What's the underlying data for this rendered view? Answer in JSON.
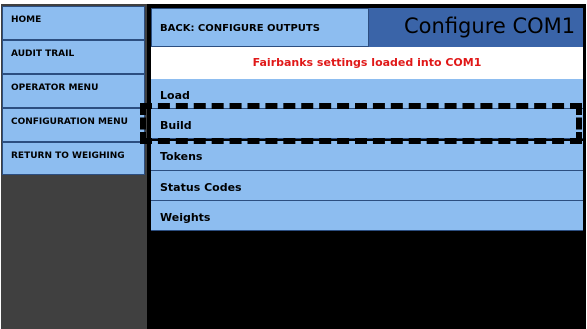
{
  "sidebar": {
    "items": [
      {
        "label": "HOME"
      },
      {
        "label": "AUDIT TRAIL"
      },
      {
        "label": "OPERATOR MENU"
      },
      {
        "label": "CONFIGURATION MENU"
      },
      {
        "label": "RETURN TO WEIGHING"
      }
    ]
  },
  "header": {
    "back_label": "BACK: CONFIGURE OUTPUTS",
    "title": "Configure COM1"
  },
  "status_message": "Fairbanks settings loaded into COM1",
  "menu": {
    "items": [
      {
        "label": "Load"
      },
      {
        "label": "Build"
      },
      {
        "label": "Tokens"
      },
      {
        "label": "Status Codes"
      },
      {
        "label": "Weights"
      }
    ]
  },
  "colors": {
    "button_blue": "#8dbdf0",
    "title_blue": "#3a64a8",
    "sidebar_bg": "#404040",
    "status_red": "#e01818"
  }
}
